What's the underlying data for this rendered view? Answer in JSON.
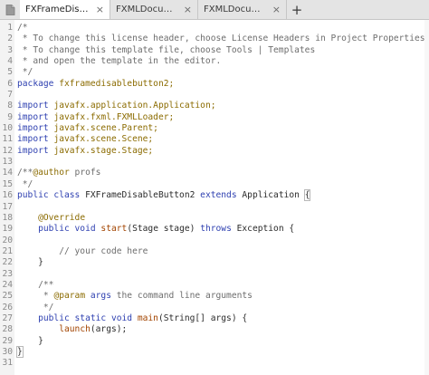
{
  "colors": {
    "keyword": "#2d3fb0",
    "comment": "#6d6d6d",
    "annotation": "#8b6b00",
    "method": "#a24400",
    "plain": "#2b2b2b",
    "line_number": "#8a8a8a",
    "tabbar_bg": "#e4e4e4"
  },
  "tabs": [
    {
      "label": "FXFrameDisableBu...",
      "close": "×",
      "active": true
    },
    {
      "label": "FXMLDocument.fx...",
      "close": "×",
      "active": false
    },
    {
      "label": "FXMLDocumentCo...",
      "close": "×",
      "active": false
    }
  ],
  "new_tab_symbol": "+",
  "file_icon": "file-icon",
  "code_lines": [
    {
      "n": "1",
      "tokens": [
        {
          "t": "/*",
          "c": "cm"
        }
      ]
    },
    {
      "n": "2",
      "tokens": [
        {
          "t": " * To change this license header, choose License Headers in Project Properties.",
          "c": "cm"
        }
      ]
    },
    {
      "n": "3",
      "tokens": [
        {
          "t": " * To change this template file, choose Tools | Templates",
          "c": "cm"
        }
      ]
    },
    {
      "n": "4",
      "tokens": [
        {
          "t": " * and open the template in the editor.",
          "c": "cm"
        }
      ]
    },
    {
      "n": "5",
      "tokens": [
        {
          "t": " */",
          "c": "cm"
        }
      ]
    },
    {
      "n": "6",
      "tokens": [
        {
          "t": "package ",
          "c": "kw"
        },
        {
          "t": "fxframedisablebutton2;",
          "c": "an"
        }
      ]
    },
    {
      "n": "7",
      "tokens": []
    },
    {
      "n": "8",
      "tokens": [
        {
          "t": "import ",
          "c": "kw"
        },
        {
          "t": "javafx.application.Application;",
          "c": "an"
        }
      ]
    },
    {
      "n": "9",
      "tokens": [
        {
          "t": "import ",
          "c": "kw"
        },
        {
          "t": "javafx.fxml.FXMLLoader;",
          "c": "an"
        }
      ]
    },
    {
      "n": "10",
      "tokens": [
        {
          "t": "import ",
          "c": "kw"
        },
        {
          "t": "javafx.scene.Parent;",
          "c": "an"
        }
      ]
    },
    {
      "n": "11",
      "tokens": [
        {
          "t": "import ",
          "c": "kw"
        },
        {
          "t": "javafx.scene.Scene;",
          "c": "an"
        }
      ]
    },
    {
      "n": "12",
      "tokens": [
        {
          "t": "import ",
          "c": "kw"
        },
        {
          "t": "javafx.stage.Stage;",
          "c": "an"
        }
      ]
    },
    {
      "n": "13",
      "tokens": []
    },
    {
      "n": "14",
      "tokens": [
        {
          "t": "/**",
          "c": "cm"
        },
        {
          "t": "@author",
          "c": "an"
        },
        {
          "t": " profs",
          "c": "cm"
        }
      ]
    },
    {
      "n": "15",
      "tokens": [
        {
          "t": " */",
          "c": "cm"
        }
      ]
    },
    {
      "n": "16",
      "tokens": [
        {
          "t": "public class ",
          "c": "kw"
        },
        {
          "t": "FXFrameDisableButton2 ",
          "c": "pl"
        },
        {
          "t": "extends ",
          "c": "kw"
        },
        {
          "t": "Application ",
          "c": "pl"
        },
        {
          "t": "{",
          "c": "pl",
          "box": true
        }
      ]
    },
    {
      "n": "17",
      "tokens": []
    },
    {
      "n": "18",
      "tokens": [
        {
          "t": "    ",
          "c": "pl"
        },
        {
          "t": "@Override",
          "c": "an"
        }
      ]
    },
    {
      "n": "19",
      "tokens": [
        {
          "t": "    public void ",
          "c": "kw"
        },
        {
          "t": "start",
          "c": "fn"
        },
        {
          "t": "(Stage stage) ",
          "c": "pl"
        },
        {
          "t": "throws ",
          "c": "kw"
        },
        {
          "t": "Exception {",
          "c": "pl"
        }
      ]
    },
    {
      "n": "20",
      "tokens": []
    },
    {
      "n": "21",
      "tokens": [
        {
          "t": "        // your code here",
          "c": "cm"
        }
      ]
    },
    {
      "n": "22",
      "tokens": [
        {
          "t": "    }",
          "c": "pl"
        }
      ]
    },
    {
      "n": "23",
      "tokens": []
    },
    {
      "n": "24",
      "tokens": [
        {
          "t": "    /**",
          "c": "cm"
        }
      ]
    },
    {
      "n": "25",
      "tokens": [
        {
          "t": "     * ",
          "c": "cm"
        },
        {
          "t": "@param ",
          "c": "an"
        },
        {
          "t": "args",
          "c": "kw"
        },
        {
          "t": " the command line arguments",
          "c": "cm"
        }
      ]
    },
    {
      "n": "26",
      "tokens": [
        {
          "t": "     */",
          "c": "cm"
        }
      ]
    },
    {
      "n": "27",
      "tokens": [
        {
          "t": "    public static void ",
          "c": "kw"
        },
        {
          "t": "main",
          "c": "fn"
        },
        {
          "t": "(String[] args) {",
          "c": "pl"
        }
      ]
    },
    {
      "n": "28",
      "tokens": [
        {
          "t": "        ",
          "c": "pl"
        },
        {
          "t": "launch",
          "c": "fn"
        },
        {
          "t": "(args);",
          "c": "pl"
        }
      ]
    },
    {
      "n": "29",
      "tokens": [
        {
          "t": "    }",
          "c": "pl"
        }
      ]
    },
    {
      "n": "30",
      "tokens": [
        {
          "t": "}",
          "c": "pl",
          "box": true
        }
      ]
    },
    {
      "n": "31",
      "tokens": []
    }
  ]
}
